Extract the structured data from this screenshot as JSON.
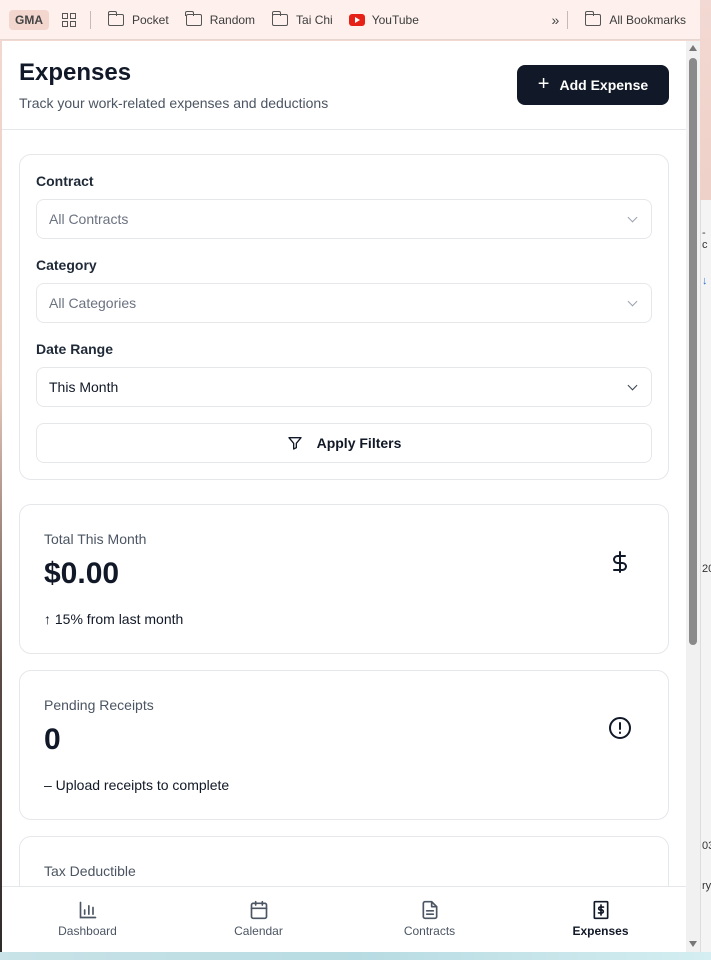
{
  "bookmarks": {
    "profile": "GMA",
    "items": [
      "Pocket",
      "Random",
      "Tai Chi",
      "YouTube"
    ],
    "overflow": "»",
    "all": "All Bookmarks"
  },
  "header": {
    "title": "Expenses",
    "subtitle": "Track your work-related expenses and deductions",
    "add_button": "Add Expense",
    "add_icon": "+"
  },
  "filters": {
    "contract_label": "Contract",
    "contract_value": "All Contracts",
    "category_label": "Category",
    "category_value": "All Categories",
    "date_label": "Date Range",
    "date_value": "This Month",
    "apply_button": "Apply Filters"
  },
  "stats": [
    {
      "label": "Total This Month",
      "value": "$0.00",
      "sub": "↑ 15% from last month",
      "icon": "dollar-icon"
    },
    {
      "label": "Pending Receipts",
      "value": "0",
      "sub": "– Upload receipts to complete",
      "icon": "alert-circle-icon"
    },
    {
      "label": "Tax Deductible"
    }
  ],
  "nav": [
    {
      "label": "Dashboard",
      "icon": "bar-chart-icon",
      "active": false
    },
    {
      "label": "Calendar",
      "icon": "calendar-icon",
      "active": false
    },
    {
      "label": "Contracts",
      "icon": "file-text-icon",
      "active": false
    },
    {
      "label": "Expenses",
      "icon": "receipt-dollar-icon",
      "active": true
    }
  ],
  "background_fragments": [
    "-c",
    "↓",
    "20",
    "03",
    "ry"
  ],
  "colors": {
    "primary": "#111827",
    "border": "#e5e7eb",
    "muted": "#4b5563"
  }
}
